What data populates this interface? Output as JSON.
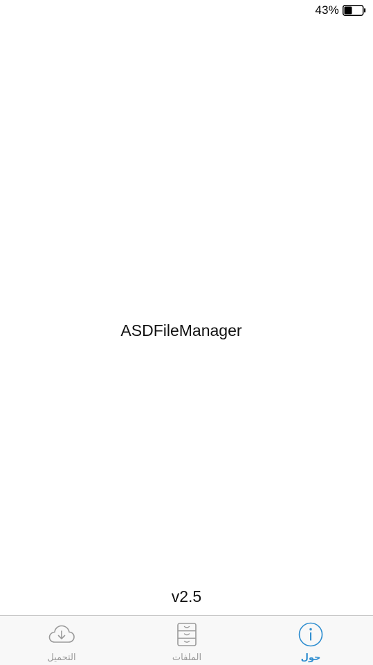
{
  "status_bar": {
    "battery_percent": "43%",
    "battery_level": 0.43,
    "battery_icon": "battery-icon"
  },
  "main": {
    "app_name": "ASDFileManager",
    "version": "v2.5"
  },
  "tab_bar": {
    "active_color": "#2f8ed0",
    "inactive_color": "#9a9a9a",
    "tabs": [
      {
        "label": "التحميل",
        "icon": "cloud-download-icon",
        "active": false
      },
      {
        "label": "الملفات",
        "icon": "file-cabinet-icon",
        "active": false
      },
      {
        "label": "حول",
        "icon": "info-icon",
        "active": true
      }
    ]
  }
}
